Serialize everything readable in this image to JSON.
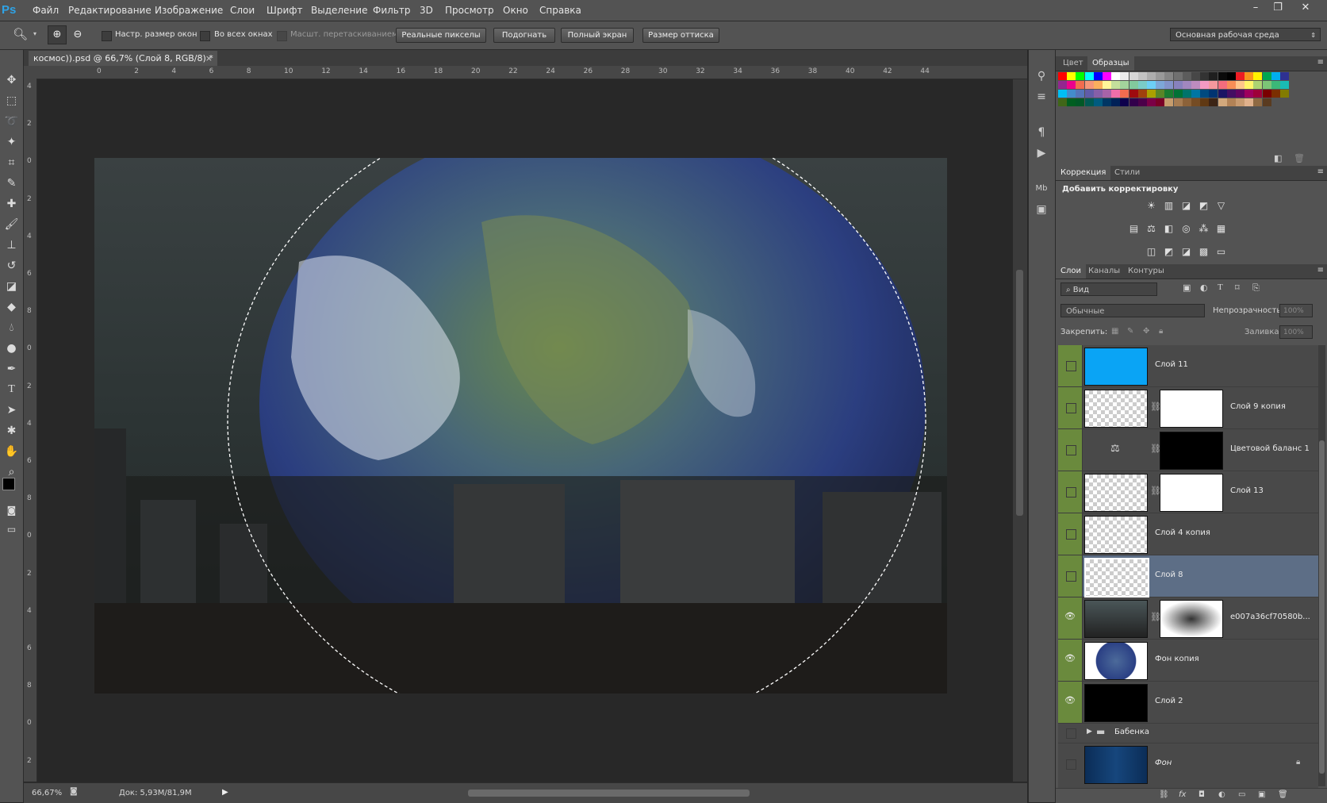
{
  "app": {
    "logo": "Ps"
  },
  "menubar": {
    "items": [
      "Файл",
      "Редактирование",
      "Изображение",
      "Слои",
      "Шрифт",
      "Выделение",
      "Фильтр",
      "3D",
      "Просмотр",
      "Окно",
      "Справка"
    ],
    "window_controls": [
      "–",
      "❐",
      "✕"
    ]
  },
  "options": {
    "fit_window": "Настр. размер окон",
    "all_windows": "Во всех окнах",
    "scrubby_zoom": "Масшт. перетаскиванием",
    "actual_pixels": "Реальные пикселы",
    "fit_screen": "Подогнать",
    "fill_screen": "Полный экран",
    "print_size": "Размер оттиска",
    "workspace": "Основная рабочая среда"
  },
  "document": {
    "tab_title": "космос)).psd @ 66,7% (Слой 8, RGB/8) *",
    "close": "×",
    "ruler_h": [
      "0",
      "2",
      "4",
      "6",
      "8",
      "10",
      "12",
      "14",
      "16",
      "18",
      "20",
      "22",
      "24",
      "26",
      "28",
      "30",
      "32",
      "34",
      "36",
      "38",
      "40",
      "42",
      "44"
    ],
    "ruler_v": [
      "4",
      "2",
      "0",
      "2",
      "4",
      "6",
      "8",
      "0",
      "2",
      "4",
      "6",
      "8",
      "0",
      "2",
      "4",
      "6",
      "8",
      "0",
      "2"
    ]
  },
  "status": {
    "zoom": "66,67%",
    "doc_size": "Док: 5,93M/81,9M"
  },
  "swatches": {
    "tabs": [
      "Цвет",
      "Образцы"
    ],
    "colors": [
      "#ff0000",
      "#ffff00",
      "#00ff00",
      "#00ffff",
      "#0000ff",
      "#ff00ff",
      "#ffffff",
      "#ebebeb",
      "#d6d6d6",
      "#c2c2c2",
      "#adadad",
      "#999999",
      "#858585",
      "#707070",
      "#5c5c5c",
      "#474747",
      "#333333",
      "#1f1f1f",
      "#0a0a0a",
      "#000000",
      "#ed1c24",
      "#f7941d",
      "#fff200",
      "#00a651",
      "#00aeef",
      "#2e3192",
      "#92278f",
      "#ec008c",
      "#f26c4f",
      "#f69679",
      "#fbaf5d",
      "#fff799",
      "#c4df9b",
      "#a3d39c",
      "#82ca9d",
      "#7accc8",
      "#6dcff6",
      "#7da7d8",
      "#8393ca",
      "#8781bd",
      "#a187be",
      "#bd8cbf",
      "#f49ac2",
      "#f5989d",
      "#f26d7d",
      "#f68e56",
      "#fdc68a",
      "#fff568",
      "#acd372",
      "#7cc576",
      "#3bb878",
      "#1abbb4",
      "#00bff3",
      "#438ccb",
      "#5574b9",
      "#605ca8",
      "#855fa8",
      "#a763a8",
      "#f06eaa",
      "#f26c4f",
      "#9e0b0f",
      "#a0410d",
      "#aba000",
      "#598527",
      "#1a7b30",
      "#007236",
      "#00746b",
      "#0076a3",
      "#004a80",
      "#003471",
      "#1b1464",
      "#440e62",
      "#630460",
      "#9e005d",
      "#9e0039",
      "#790000",
      "#7b2e00",
      "#827b00",
      "#406618",
      "#005e20",
      "#005826",
      "#005952",
      "#005b7f",
      "#003663",
      "#002157",
      "#0d004c",
      "#32004b",
      "#4b0049",
      "#7b0046",
      "#7a0026",
      "#c69c6d",
      "#a67c52",
      "#8c6239",
      "#754c24",
      "#603913",
      "#3c2415",
      "#d2a87c",
      "#b28256",
      "#c79a70",
      "#e0b18c",
      "#8f6a43",
      "#5a3b20"
    ]
  },
  "adjustments": {
    "tabs": [
      "Коррекция",
      "Стили"
    ],
    "title": "Добавить корректировку",
    "row1": [
      "☀",
      "▥",
      "◪",
      "◩",
      "▽"
    ],
    "row2": [
      "▤",
      "⚖",
      "◧",
      "◎",
      "⁂",
      "▦"
    ],
    "row3": [
      "◫",
      "◩",
      "◪",
      "▩",
      "▭"
    ]
  },
  "layers_panel": {
    "tabs": [
      "Слои",
      "Каналы",
      "Контуры"
    ],
    "filter": "Вид",
    "blend_mode": "Обычные",
    "opacity_label": "Непрозрачность:",
    "opacity_value": "100%",
    "lock_label": "Закрепить:",
    "fill_label": "Заливка:",
    "fill_value": "100%",
    "layers": [
      {
        "name": "Слой 11",
        "visible": false
      },
      {
        "name": "Слой 9 копия",
        "visible": false
      },
      {
        "name": "Цветовой баланс 1",
        "visible": false
      },
      {
        "name": "Слой 13",
        "visible": false
      },
      {
        "name": "Слой 4 копия",
        "visible": false
      },
      {
        "name": "Слой 8",
        "visible": false,
        "selected": true
      },
      {
        "name": "e007a36cf70580b...",
        "visible": true
      },
      {
        "name": "Фон копия",
        "visible": true
      },
      {
        "name": "Слой 2",
        "visible": true
      }
    ],
    "group": {
      "name": "Бабенка"
    },
    "background": {
      "name": "Фон"
    },
    "footer_icons": [
      "⛓",
      "fx",
      "◘",
      "◐",
      "▭",
      "▣",
      "🗑"
    ]
  }
}
